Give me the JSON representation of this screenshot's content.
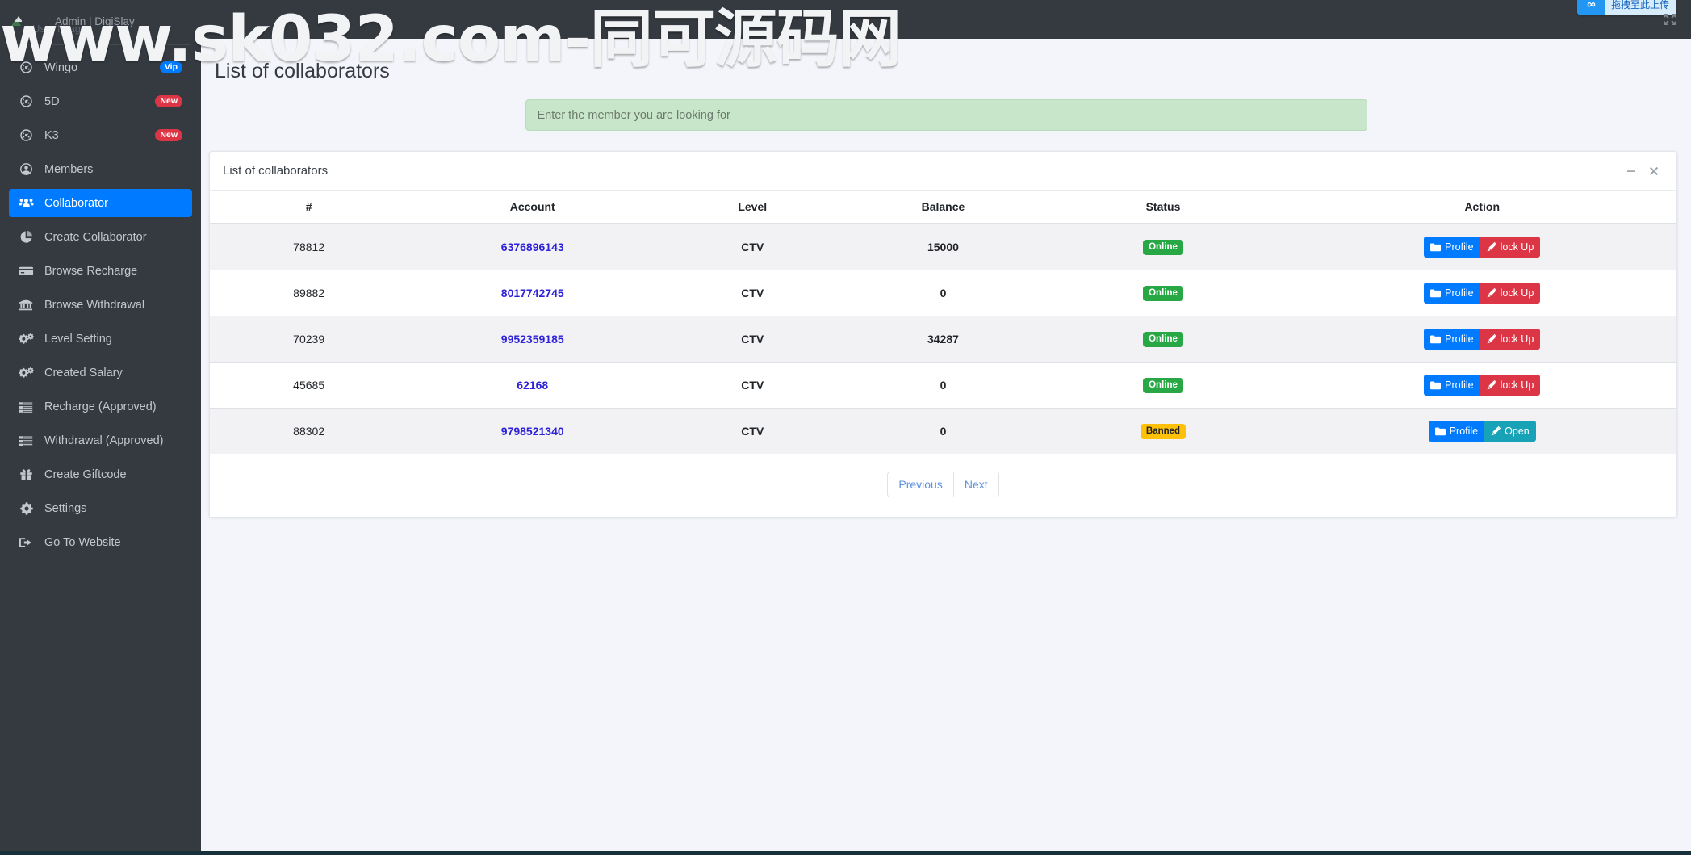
{
  "watermark": {
    "text": "www.sk032.com-同可源码网"
  },
  "sidebar": {
    "brand": {
      "image_alt": "User Image",
      "name": "Admin | DigiSlay"
    },
    "items": [
      {
        "label": "Wingo",
        "icon": "gauge-icon",
        "badge": "Vip",
        "badge_type": "vip",
        "active": false
      },
      {
        "label": "5D",
        "icon": "gauge-icon",
        "badge": "New",
        "badge_type": "new",
        "active": false
      },
      {
        "label": "K3",
        "icon": "gauge-icon",
        "badge": "New",
        "badge_type": "new",
        "active": false
      },
      {
        "label": "Members",
        "icon": "user-circle-icon",
        "badge": "",
        "badge_type": "",
        "active": false
      },
      {
        "label": "Collaborator",
        "icon": "users-group-icon",
        "badge": "",
        "badge_type": "",
        "active": true
      },
      {
        "label": "Create Collaborator",
        "icon": "pie-chart-icon",
        "badge": "",
        "badge_type": "",
        "active": false
      },
      {
        "label": "Browse Recharge",
        "icon": "credit-card-icon",
        "badge": "",
        "badge_type": "",
        "active": false
      },
      {
        "label": "Browse Withdrawal",
        "icon": "bank-icon",
        "badge": "",
        "badge_type": "",
        "active": false
      },
      {
        "label": "Level Setting",
        "icon": "cogs-icon",
        "badge": "",
        "badge_type": "",
        "active": false
      },
      {
        "label": "Created Salary",
        "icon": "cogs-icon",
        "badge": "",
        "badge_type": "",
        "active": false
      },
      {
        "label": "Recharge (Approved)",
        "icon": "list-icon",
        "badge": "",
        "badge_type": "",
        "active": false
      },
      {
        "label": "Withdrawal (Approved)",
        "icon": "list-icon",
        "badge": "",
        "badge_type": "",
        "active": false
      },
      {
        "label": "Create Giftcode",
        "icon": "gift-icon",
        "badge": "",
        "badge_type": "",
        "active": false
      },
      {
        "label": "Settings",
        "icon": "gear-icon",
        "badge": "",
        "badge_type": "",
        "active": false
      },
      {
        "label": "Go To Website",
        "icon": "sign-out-icon",
        "badge": "",
        "badge_type": "",
        "active": false
      }
    ]
  },
  "topbar": {
    "upload_badge": {
      "icon": "infinity-icon",
      "text": "拖拽至此上传"
    },
    "fullscreen_icon": "fullscreen-icon"
  },
  "page": {
    "title": "List of collaborators"
  },
  "search": {
    "value": "",
    "placeholder": "Enter the member you are looking for"
  },
  "card": {
    "title": "List of collaborators",
    "minimize_icon": "minimize-icon",
    "close_icon": "close-icon"
  },
  "table": {
    "headers": [
      "#",
      "Account",
      "Level",
      "Balance",
      "Status",
      "Action"
    ],
    "rows": [
      {
        "id": "78812",
        "account": "6376896143",
        "level": "CTV",
        "balance": "15000",
        "status": "Online",
        "status_type": "online",
        "profile_label": "Profile",
        "action_label": "lock Up",
        "action_type": "lock"
      },
      {
        "id": "89882",
        "account": "8017742745",
        "level": "CTV",
        "balance": "0",
        "status": "Online",
        "status_type": "online",
        "profile_label": "Profile",
        "action_label": "lock Up",
        "action_type": "lock"
      },
      {
        "id": "70239",
        "account": "9952359185",
        "level": "CTV",
        "balance": "34287",
        "status": "Online",
        "status_type": "online",
        "profile_label": "Profile",
        "action_label": "lock Up",
        "action_type": "lock"
      },
      {
        "id": "45685",
        "account": "62168",
        "level": "CTV",
        "balance": "0",
        "status": "Online",
        "status_type": "online",
        "profile_label": "Profile",
        "action_label": "lock Up",
        "action_type": "lock"
      },
      {
        "id": "88302",
        "account": "9798521340",
        "level": "CTV",
        "balance": "0",
        "status": "Banned",
        "status_type": "banned",
        "profile_label": "Profile",
        "action_label": "Open",
        "action_type": "open"
      }
    ]
  },
  "pagination": {
    "previous": "Previous",
    "next": "Next"
  },
  "colors": {
    "sidebar_bg": "#343a40",
    "accent_blue": "#007bff",
    "danger_red": "#dc3545",
    "success_green": "#28a745",
    "warning_yellow": "#ffc107",
    "teal": "#17a2b8",
    "link_blue": "#2d21d9",
    "search_green": "#c8e6c9",
    "content_bg": "#f4f5fb"
  }
}
